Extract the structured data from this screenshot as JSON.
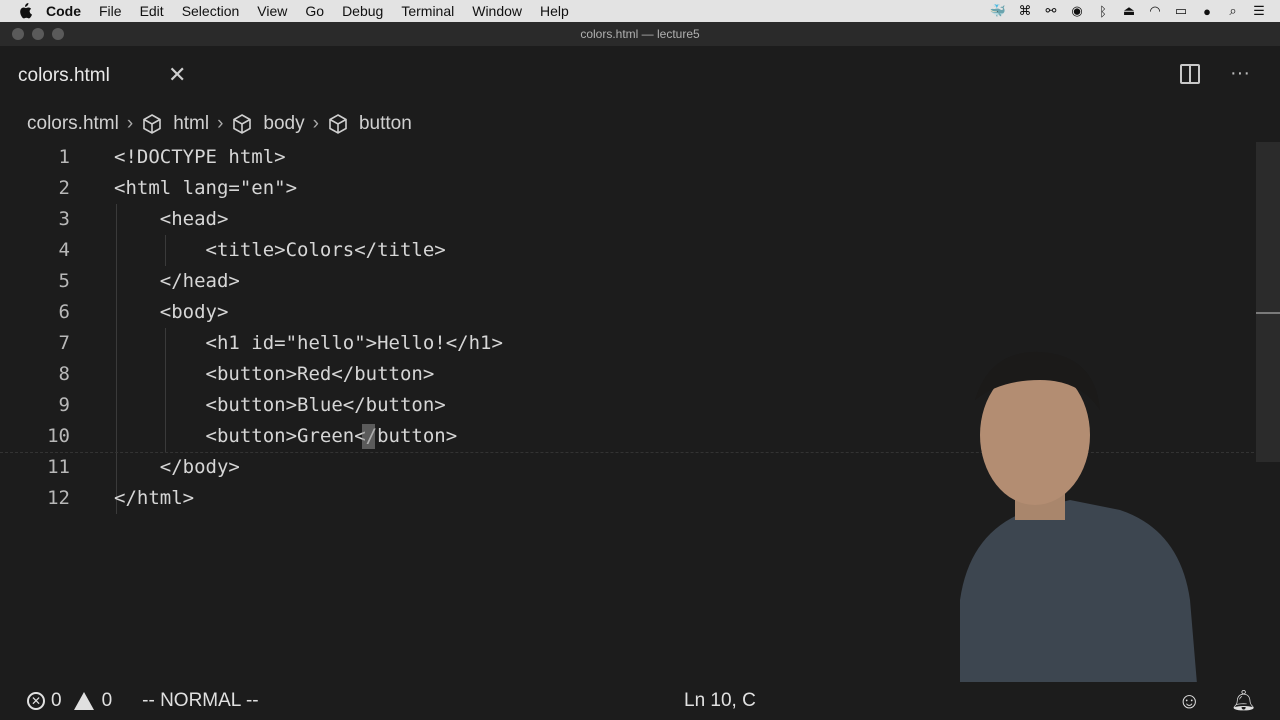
{
  "menubar": {
    "apple_icon": "apple-icon",
    "items": [
      "Code",
      "File",
      "Edit",
      "Selection",
      "View",
      "Go",
      "Debug",
      "Terminal",
      "Window",
      "Help"
    ],
    "status_icons": [
      "docker-icon",
      "command-icon",
      "glasses-icon",
      "circle-icon",
      "bluetooth-icon",
      "eject-icon",
      "wifi-icon",
      "battery-icon",
      "user-icon",
      "search-icon",
      "list-icon"
    ]
  },
  "window": {
    "title": "colors.html — lecture5"
  },
  "tab": {
    "label": "colors.html",
    "close": "✕"
  },
  "breadcrumb": [
    "colors.html",
    "html",
    "body",
    "button"
  ],
  "editor": {
    "lines": [
      {
        "n": "1",
        "text": "<!DOCTYPE html>"
      },
      {
        "n": "2",
        "text": "<html lang=\"en\">"
      },
      {
        "n": "3",
        "text": "    <head>"
      },
      {
        "n": "4",
        "text": "        <title>Colors</title>"
      },
      {
        "n": "5",
        "text": "    </head>"
      },
      {
        "n": "6",
        "text": "    <body>"
      },
      {
        "n": "7",
        "text": "        <h1 id=\"hello\">Hello!</h1>"
      },
      {
        "n": "8",
        "text": "        <button>Red</button>"
      },
      {
        "n": "9",
        "text": "        <button>Blue</button>"
      },
      {
        "n": "10",
        "text": "        <button>Green</button>"
      },
      {
        "n": "11",
        "text": "    </body>"
      },
      {
        "n": "12",
        "text": "</html>"
      }
    ]
  },
  "statusbar": {
    "errors": "0",
    "warnings": "0",
    "mode": "-- NORMAL --",
    "position": "Ln 10, C",
    "icons": [
      "smiley-icon",
      "bell-icon"
    ]
  },
  "colors": {
    "background": "#1c1c1c",
    "menubar": "#e3e3e3",
    "text": "#d4d4d4"
  }
}
